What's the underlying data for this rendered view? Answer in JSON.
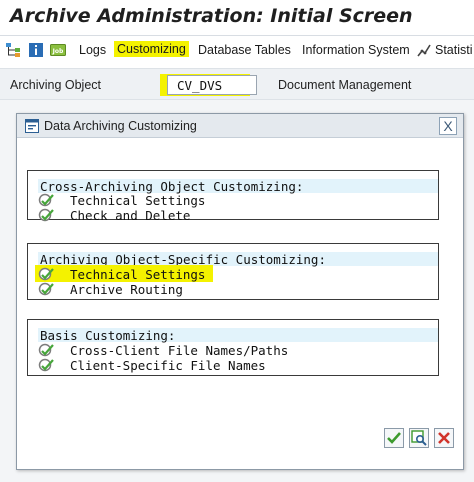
{
  "window": {
    "title": "Archive Administration: Initial Screen"
  },
  "menu": {
    "items": [
      {
        "label": "Logs"
      },
      {
        "label": "Customizing",
        "highlighted": true
      },
      {
        "label": "Database Tables"
      },
      {
        "label": "Information System"
      },
      {
        "label": "Statisti"
      }
    ]
  },
  "archiving_object": {
    "label": "Archiving Object",
    "value": "CV_DVS",
    "description": "Document Management"
  },
  "dialog": {
    "title": "Data Archiving Customizing",
    "close_glyph": "X",
    "groups": [
      {
        "title": "Cross-Archiving Object Customizing:",
        "options": [
          {
            "label": "Technical Settings"
          },
          {
            "label": "Check and Delete"
          }
        ]
      },
      {
        "title": "Archiving Object-Specific Customizing:",
        "options": [
          {
            "label": "Technical Settings",
            "highlighted": true
          },
          {
            "label": "Archive Routing"
          }
        ]
      },
      {
        "title": "Basis Customizing:",
        "options": [
          {
            "label": "Cross-Client File Names/Paths"
          },
          {
            "label": "Client-Specific File Names"
          }
        ]
      }
    ],
    "buttons": [
      {
        "icon": "checkmark-icon"
      },
      {
        "icon": "view-icon"
      },
      {
        "icon": "cancel-icon"
      }
    ]
  },
  "colors": {
    "highlight": "#f4f200",
    "group_header": "#e2f3fb",
    "dialog_header": "#e4e9ee"
  }
}
